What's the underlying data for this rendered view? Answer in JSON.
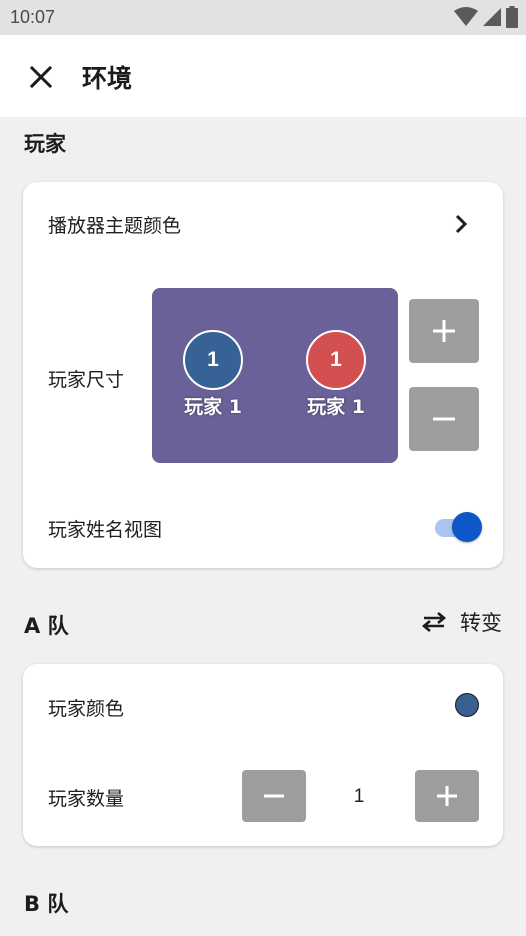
{
  "status_bar": {
    "time": "10:07",
    "icons": [
      "wifi-icon",
      "cellular-icon",
      "battery-icon"
    ]
  },
  "app_bar": {
    "title": "环境",
    "close_icon": "close-icon"
  },
  "players_section": {
    "title": "玩家",
    "theme_color_label": "播放器主题颜色",
    "player_size_label": "玩家尺寸",
    "preview": {
      "background": "#6b6199",
      "players": [
        {
          "number": "1",
          "name": "玩家 1",
          "color": "#376296"
        },
        {
          "number": "1",
          "name": "玩家 1",
          "color": "#d35050"
        }
      ]
    },
    "name_view_label": "玩家姓名视图",
    "name_view_enabled": true
  },
  "team_a": {
    "title": "A 队",
    "swap_label": "转变",
    "color_label": "玩家颜色",
    "color": "#3a5f91",
    "count_label": "玩家数量",
    "count": "1"
  },
  "team_b": {
    "title": "B 队"
  },
  "colors": {
    "accent": "#0d57c8",
    "button_gray": "#9e9e9e"
  }
}
